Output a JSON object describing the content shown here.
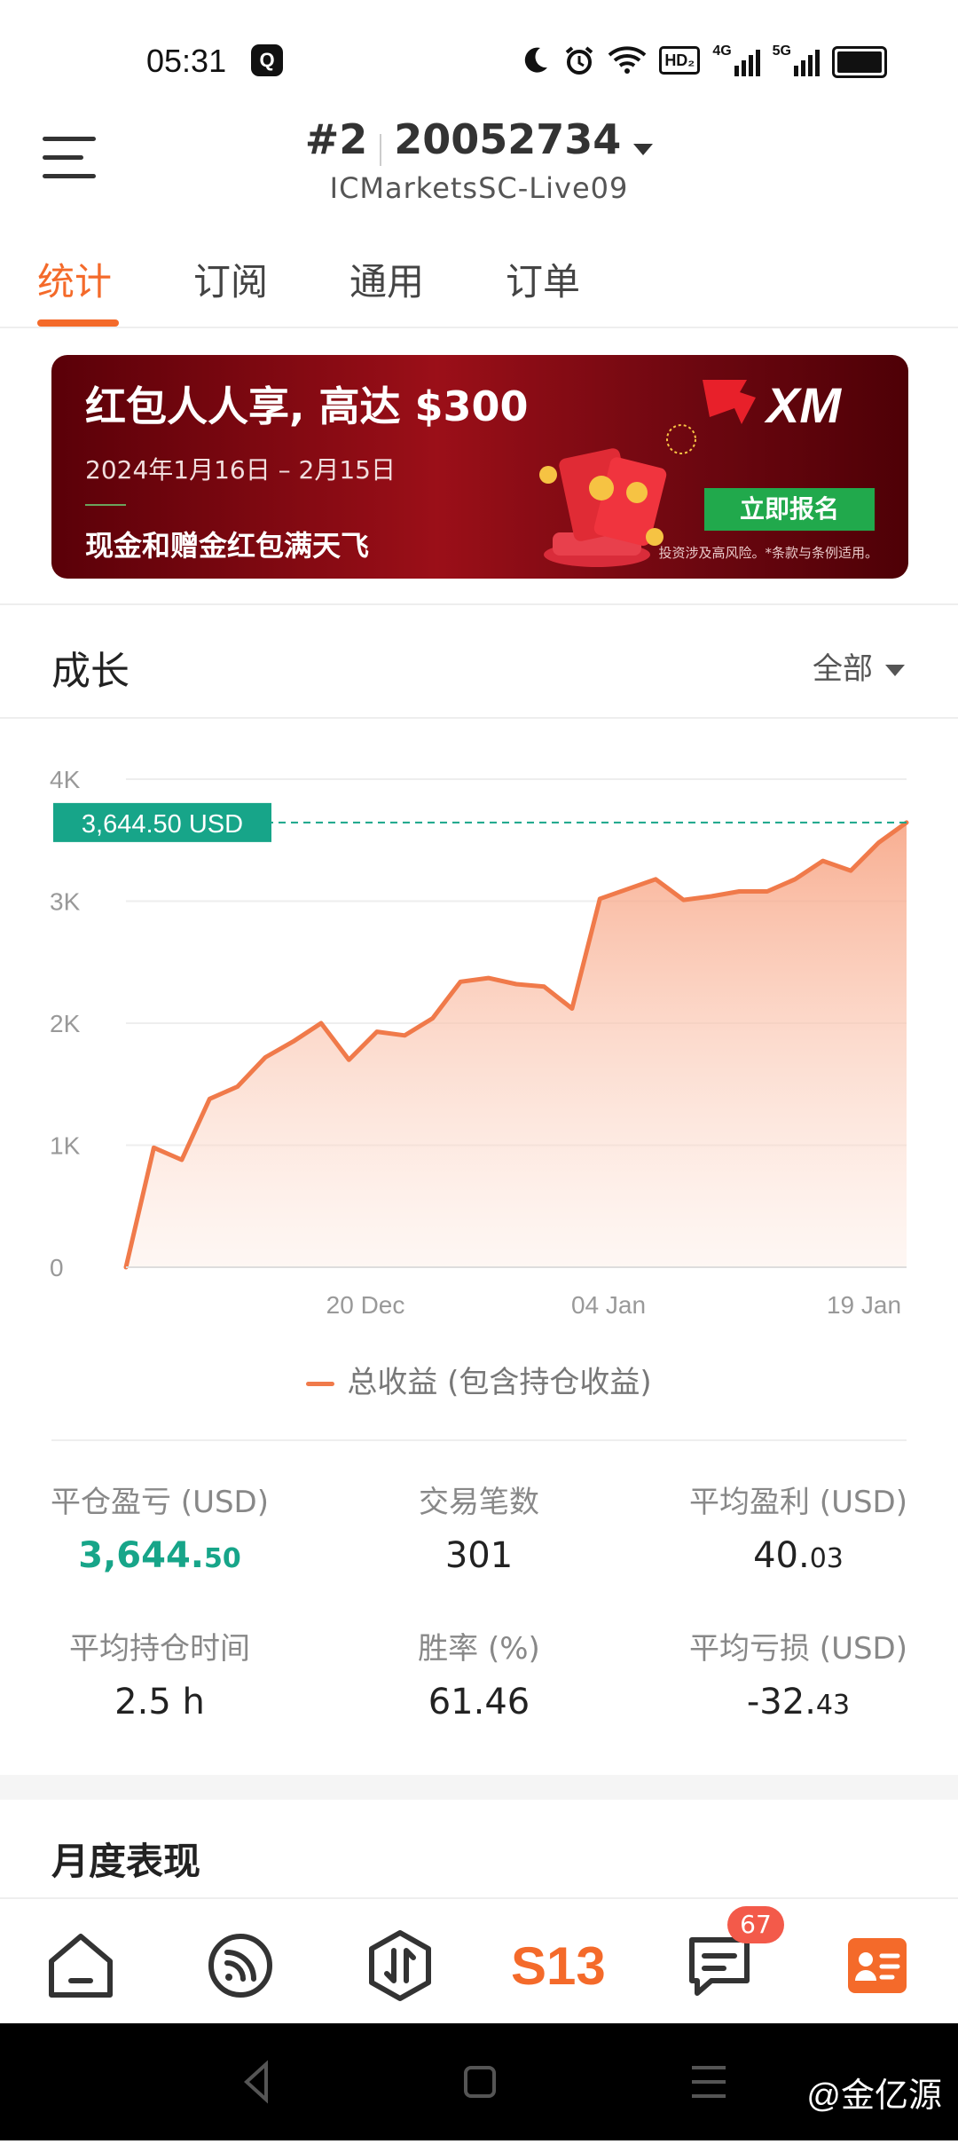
{
  "status": {
    "time": "05:31",
    "app_icon": "Q",
    "icons": [
      "moon-icon",
      "alarm-icon",
      "wifi-icon",
      "hd-icon",
      "signal-4g-icon",
      "signal-5g-icon",
      "battery-icon"
    ],
    "hd_label": "HD₂",
    "net1": "4G",
    "net2": "5G"
  },
  "header": {
    "account_index": "#2",
    "account_number": "20052734",
    "server": "ICMarketsSC-Live09"
  },
  "tabs": [
    {
      "label": "统计",
      "active": true
    },
    {
      "label": "订阅",
      "active": false
    },
    {
      "label": "通用",
      "active": false
    },
    {
      "label": "订单",
      "active": false
    }
  ],
  "banner": {
    "headline": "红包人人享, 高达 $300",
    "date_range": "2024年1月16日 – 2月15日",
    "subline": "现金和赠金红包满天飞",
    "brand": "XM",
    "cta": "立即报名",
    "disclaimer": "投资涉及高风险。*条款与条例适用。"
  },
  "growth": {
    "title": "成长",
    "filter": "全部"
  },
  "chart_data": {
    "type": "area",
    "title": "",
    "ylabel": "",
    "xlabel": "",
    "y_ticks": [
      "0",
      "1K",
      "2K",
      "3K",
      "4K"
    ],
    "ylim": [
      0,
      4000
    ],
    "x_ticks": [
      "20 Dec",
      "04 Jan",
      "19 Jan"
    ],
    "current_value_label": "3,644.50 USD",
    "current_value": 3644.5,
    "series": [
      {
        "name": "总收益 (包含持仓收益)",
        "color": "#f07a4a",
        "values": [
          0,
          980,
          880,
          1380,
          1480,
          1720,
          1850,
          2000,
          1700,
          1930,
          1900,
          2040,
          2340,
          2370,
          2320,
          2300,
          2120,
          3020,
          3100,
          3180,
          3010,
          3040,
          3080,
          3080,
          3180,
          3330,
          3250,
          3480,
          3644.5
        ]
      }
    ],
    "grid": true,
    "legend": "bottom"
  },
  "legend_label": "总收益 (包含持仓收益)",
  "stats": [
    {
      "label": "平仓盈亏 (USD)",
      "value_main": "3,644.",
      "value_dec": "50",
      "highlight": true
    },
    {
      "label": "交易笔数",
      "value_main": "301",
      "value_dec": "",
      "highlight": false
    },
    {
      "label": "平均盈利 (USD)",
      "value_main": "40.",
      "value_dec": "03",
      "highlight": false
    },
    {
      "label": "平均持仓时间",
      "value_main": "2.5 h",
      "value_dec": "",
      "highlight": false
    },
    {
      "label": "胜率 (%)",
      "value_main": "61.46",
      "value_dec": "",
      "highlight": false
    },
    {
      "label": "平均亏损 (USD)",
      "value_main": "-32.",
      "value_dec": "43",
      "highlight": false
    }
  ],
  "monthly_title": "月度表现",
  "bottom_nav": {
    "items": [
      "home-icon",
      "feed-icon",
      "trade-icon",
      "s13-icon",
      "messages-icon",
      "profile-icon"
    ],
    "center_label": "S13",
    "badge": "67"
  },
  "watermark": "@金亿源",
  "colors": {
    "accent": "#f46a2a",
    "green": "#17a589",
    "line": "#f07a4a"
  }
}
